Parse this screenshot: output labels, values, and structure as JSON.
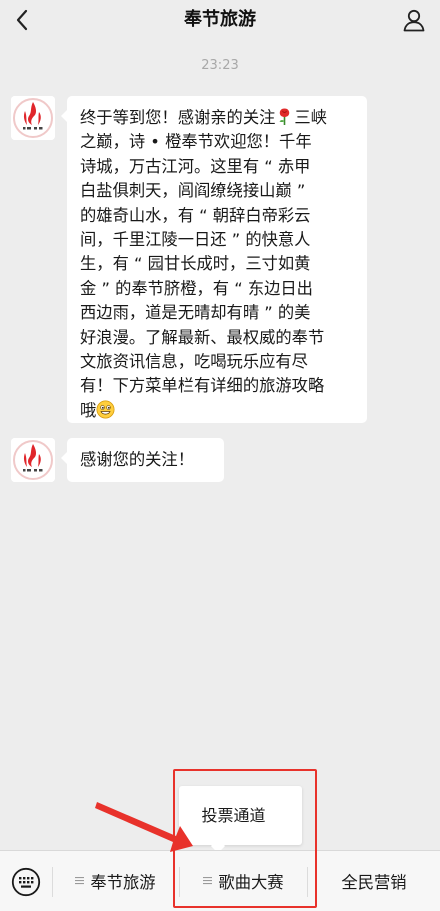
{
  "header": {
    "title": "奉节旅游",
    "back_icon": "chevron-left-icon",
    "profile_icon": "person-icon"
  },
  "chat": {
    "timestamp": "23:23",
    "messages": [
      {
        "sender": "奉节旅游",
        "lines": [
          "终于等到您！感谢亲的关注",
          "之巅，诗 • 橙奉节欢迎您！千年",
          "诗城，万古江河。这里有 “ 赤甲",
          "白盐俱刺天，闾阎缭绕接山巅 ”",
          "的雄奇山水，有 “ 朝辞白帝彩云",
          "间，千里江陵一日还 ” 的快意人",
          "生，有 “ 园甘长成时，三寸如黄",
          "金 ” 的奉节脐橙，有 “ 东边日出",
          "西边雨，道是无晴却有晴 ” 的美",
          "好浪漫。了解最新、最权威的奉节",
          "文旅资讯信息，吃喝玩乐应有尽",
          "有！下方菜单栏有详细的旅游攻略",
          "哦"
        ],
        "line1_tail": "三峡",
        "emoji_1": "rose-emoji",
        "emoji_2": "grinning-face-emoji"
      },
      {
        "sender": "奉节旅游",
        "text": "感谢您的关注！"
      }
    ]
  },
  "submenu": {
    "items": [
      "投票通道"
    ]
  },
  "menu_bar": {
    "keyboard_icon": "keyboard-icon",
    "tabs": [
      "奉节旅游",
      "歌曲大赛",
      "全民营销"
    ]
  },
  "colors": {
    "background": "#ededed",
    "bubble": "#ffffff",
    "annotation_red": "#e8322b",
    "logo_red": "#e0262b"
  }
}
